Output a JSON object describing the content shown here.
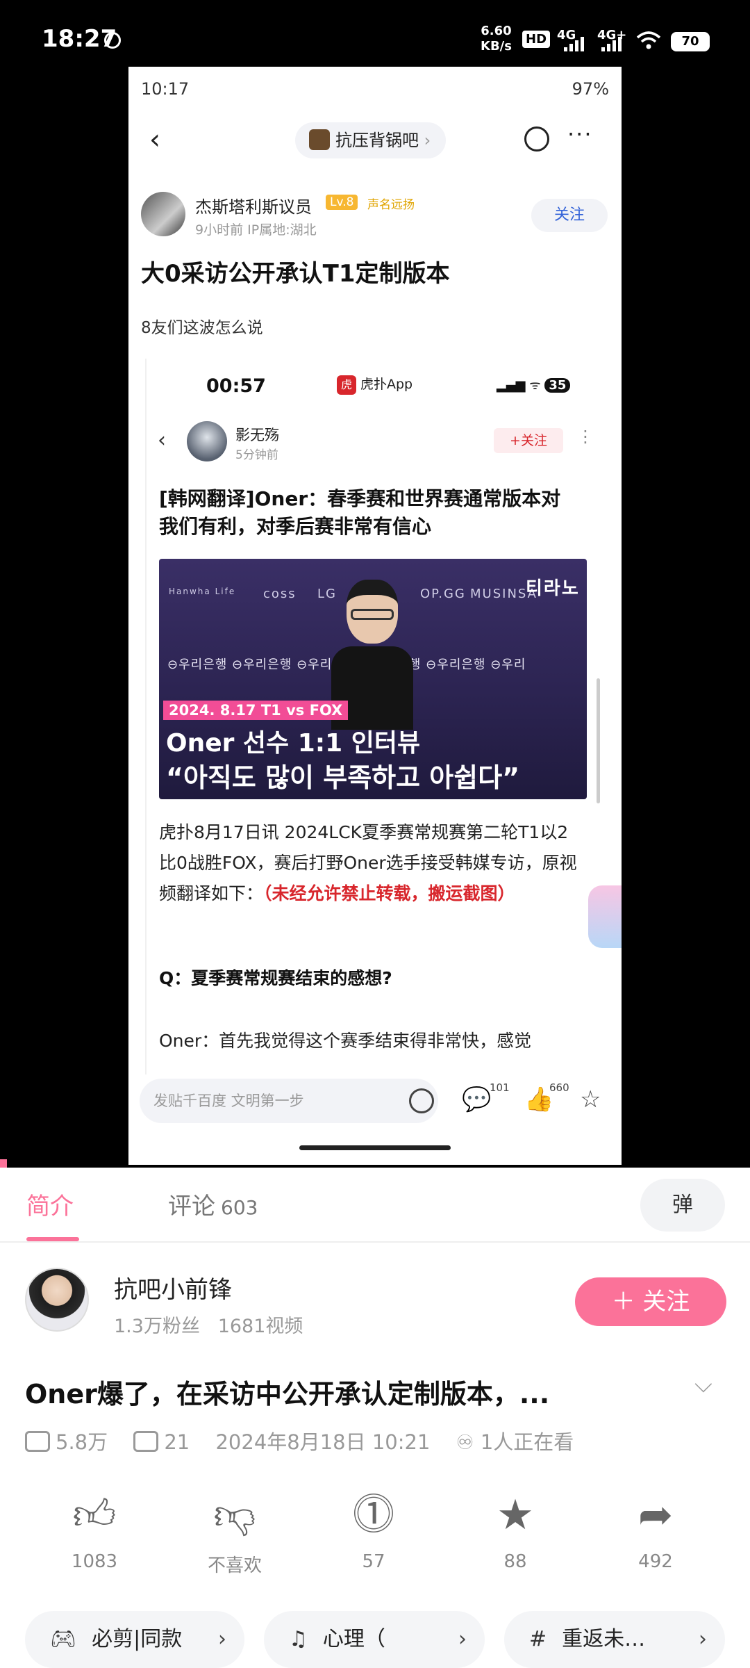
{
  "status_bar": {
    "time": "18:27",
    "speed_value": "6.60",
    "speed_unit": "KB/s",
    "hd": "HD",
    "net1": "4G",
    "net2": "4G+",
    "battery": "70"
  },
  "phone": {
    "status": {
      "time": "10:17",
      "right": "97%"
    },
    "forum": "抗压背锅吧",
    "author": {
      "name": "杰斯塔利斯议员",
      "level": "Lv.8",
      "badge": "声名远扬",
      "meta": "9小时前   IP属地:湖北",
      "follow": "关注"
    },
    "title": "大0采访公开承认T1定制版本",
    "body": "8友们这波怎么说",
    "inner": {
      "time": "00:57",
      "app": "虎扑App",
      "app_icon": "虎扑",
      "battery": "35",
      "author": {
        "name": "影无殇",
        "meta": "5分钟前",
        "follow": "+关注"
      },
      "headline": "[韩网翻译]Oner：春季赛和世界赛通常版本对我们有利，对季后赛非常有信心",
      "image": {
        "logos": [
          "Hanwha Life",
          "coss",
          "LG",
          "OP.GG",
          "MUSINSA",
          "티라노"
        ],
        "bank_row": "⊖우리은행  ⊖우리은행  ⊖우리은행  ⊖우리은행  ⊖우리은행  ⊖우리",
        "date_tag": "2024. 8.17  T1 vs FOX",
        "line1": "Oner 선수 1:1 인터뷰",
        "line2": "“아직도 많이 부족하고 아쉽다”"
      },
      "paragraph": "虎扑8月17日讯 2024LCK夏季赛常规赛第二轮T1以2比0战胜FOX，赛后打野Oner选手接受韩媒专访，原视频翻译如下：",
      "paragraph_red": "（未经允许禁止转载，搬运截图）",
      "question": "Q：夏季赛常规赛结束的感想?",
      "answer": "Oner：首先我觉得这个赛季结束得非常快，感觉"
    },
    "bottom": {
      "placeholder": "发贴千百度 文明第一步",
      "comments": "101",
      "likes": "660"
    }
  },
  "tabs": {
    "intro": "简介",
    "comments": "评论",
    "comments_count": "603",
    "danmu": "弹"
  },
  "uploader": {
    "name": "抗吧小前锋",
    "fans": "1.3万粉丝",
    "videos": "1681视频",
    "follow": "＋ 关注"
  },
  "video": {
    "title": "Oner爆了，在采访中公开承认定制版本，...",
    "views": "5.8万",
    "danmaku": "21",
    "date": "2024年8月18日 10:21",
    "watching": "1人正在看"
  },
  "actions": [
    {
      "icon": "like-icon",
      "label": "1083"
    },
    {
      "icon": "dislike-icon",
      "label": "不喜欢"
    },
    {
      "icon": "coin-icon",
      "label": "57"
    },
    {
      "icon": "star-icon",
      "label": "88"
    },
    {
      "icon": "share-icon",
      "label": "492"
    }
  ],
  "chips": [
    {
      "icon": "gamepad-icon",
      "label": "必剪|同款"
    },
    {
      "icon": "music-icon",
      "label": "心理（"
    },
    {
      "icon": "hashtag-icon",
      "label": "重返未…"
    }
  ],
  "colors": {
    "accent": "#fb7299",
    "link_blue": "#3564d8",
    "hupu_red": "#d8262c"
  }
}
